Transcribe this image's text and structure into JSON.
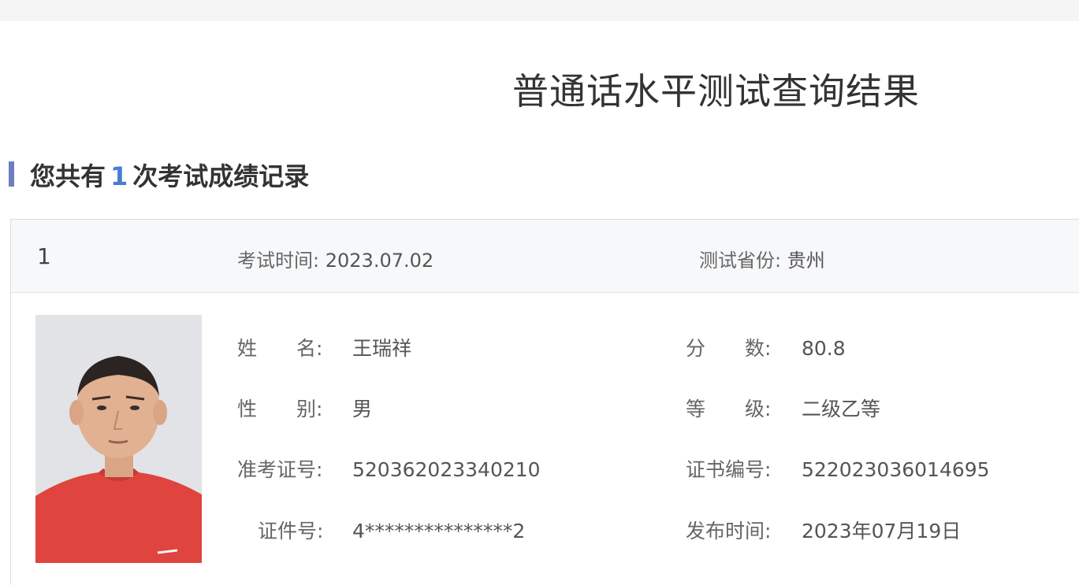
{
  "page": {
    "title": "普通话水平测试查询结果"
  },
  "summary": {
    "prefix": "您共有",
    "count": "1",
    "suffix": "次考试成绩记录"
  },
  "record": {
    "index": "1",
    "exam_time_label": "考试时间:",
    "exam_time_value": "2023.07.02",
    "province_label": "测试省份:",
    "province_value": "贵州",
    "fields_left": [
      {
        "label": "姓　　名:",
        "value": "王瑞祥"
      },
      {
        "label": "性　　别:",
        "value": "男"
      },
      {
        "label": "准考证号:",
        "value": "520362023340210"
      },
      {
        "label": "证件号:",
        "value": "4***************2"
      }
    ],
    "fields_right": [
      {
        "label": "分　　数:",
        "value": "80.8"
      },
      {
        "label": "等　　级:",
        "value": "二级乙等"
      },
      {
        "label": "证书编号:",
        "value": "522023036014695"
      },
      {
        "label": "发布时间:",
        "value": "2023年07月19日"
      }
    ]
  },
  "colors": {
    "accent_bar": "#6b7fbf",
    "count_blue": "#4a7bd4",
    "photo_background": "#dfe0e3",
    "shirt_red": "#e0443e"
  }
}
